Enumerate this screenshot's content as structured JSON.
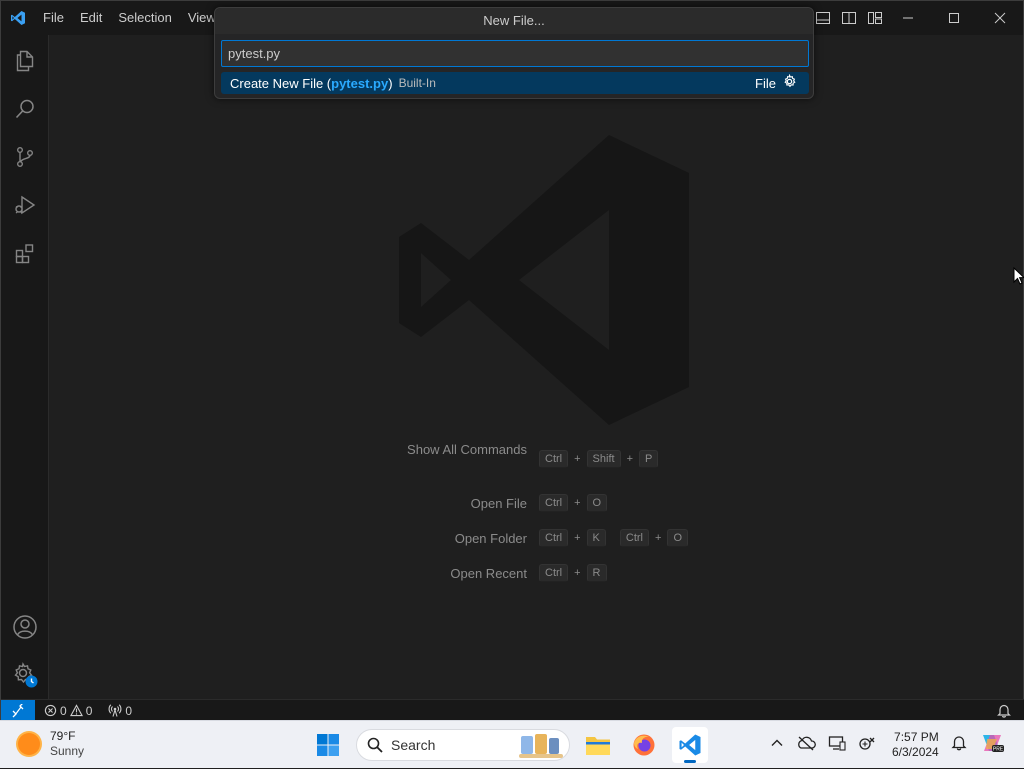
{
  "titlebar": {
    "menu": [
      "File",
      "Edit",
      "Selection",
      "View"
    ]
  },
  "quick_pick": {
    "title": "New File...",
    "input_value": "pytest.py",
    "item": {
      "prefix": "Create New File (",
      "highlight": "pytest.py",
      "suffix": ")",
      "description": "Built-In",
      "category": "File"
    }
  },
  "activity_bar": [
    "files-icon",
    "search-icon",
    "source-control-icon",
    "run-debug-icon",
    "extensions-icon",
    "account-icon",
    "manage-gear-icon"
  ],
  "shortcuts": [
    {
      "label": "Show All Commands",
      "keys": [
        [
          "Ctrl",
          "Shift",
          "P"
        ]
      ]
    },
    {
      "label": "Open File",
      "keys": [
        [
          "Ctrl",
          "O"
        ]
      ]
    },
    {
      "label": "Open Folder",
      "keys": [
        [
          "Ctrl",
          "K"
        ],
        [
          "Ctrl",
          "O"
        ]
      ]
    },
    {
      "label": "Open Recent",
      "keys": [
        [
          "Ctrl",
          "R"
        ]
      ]
    }
  ],
  "status_bar": {
    "errors": "0",
    "warnings": "0",
    "ports": "0"
  },
  "taskbar": {
    "weather_temp": "79°F",
    "weather_desc": "Sunny",
    "search_placeholder": "Search",
    "time": "7:57 PM",
    "date": "6/3/2024"
  },
  "colors": {
    "accent": "#0078d4",
    "highlight": "#2aaaff",
    "selection": "#04395e"
  }
}
